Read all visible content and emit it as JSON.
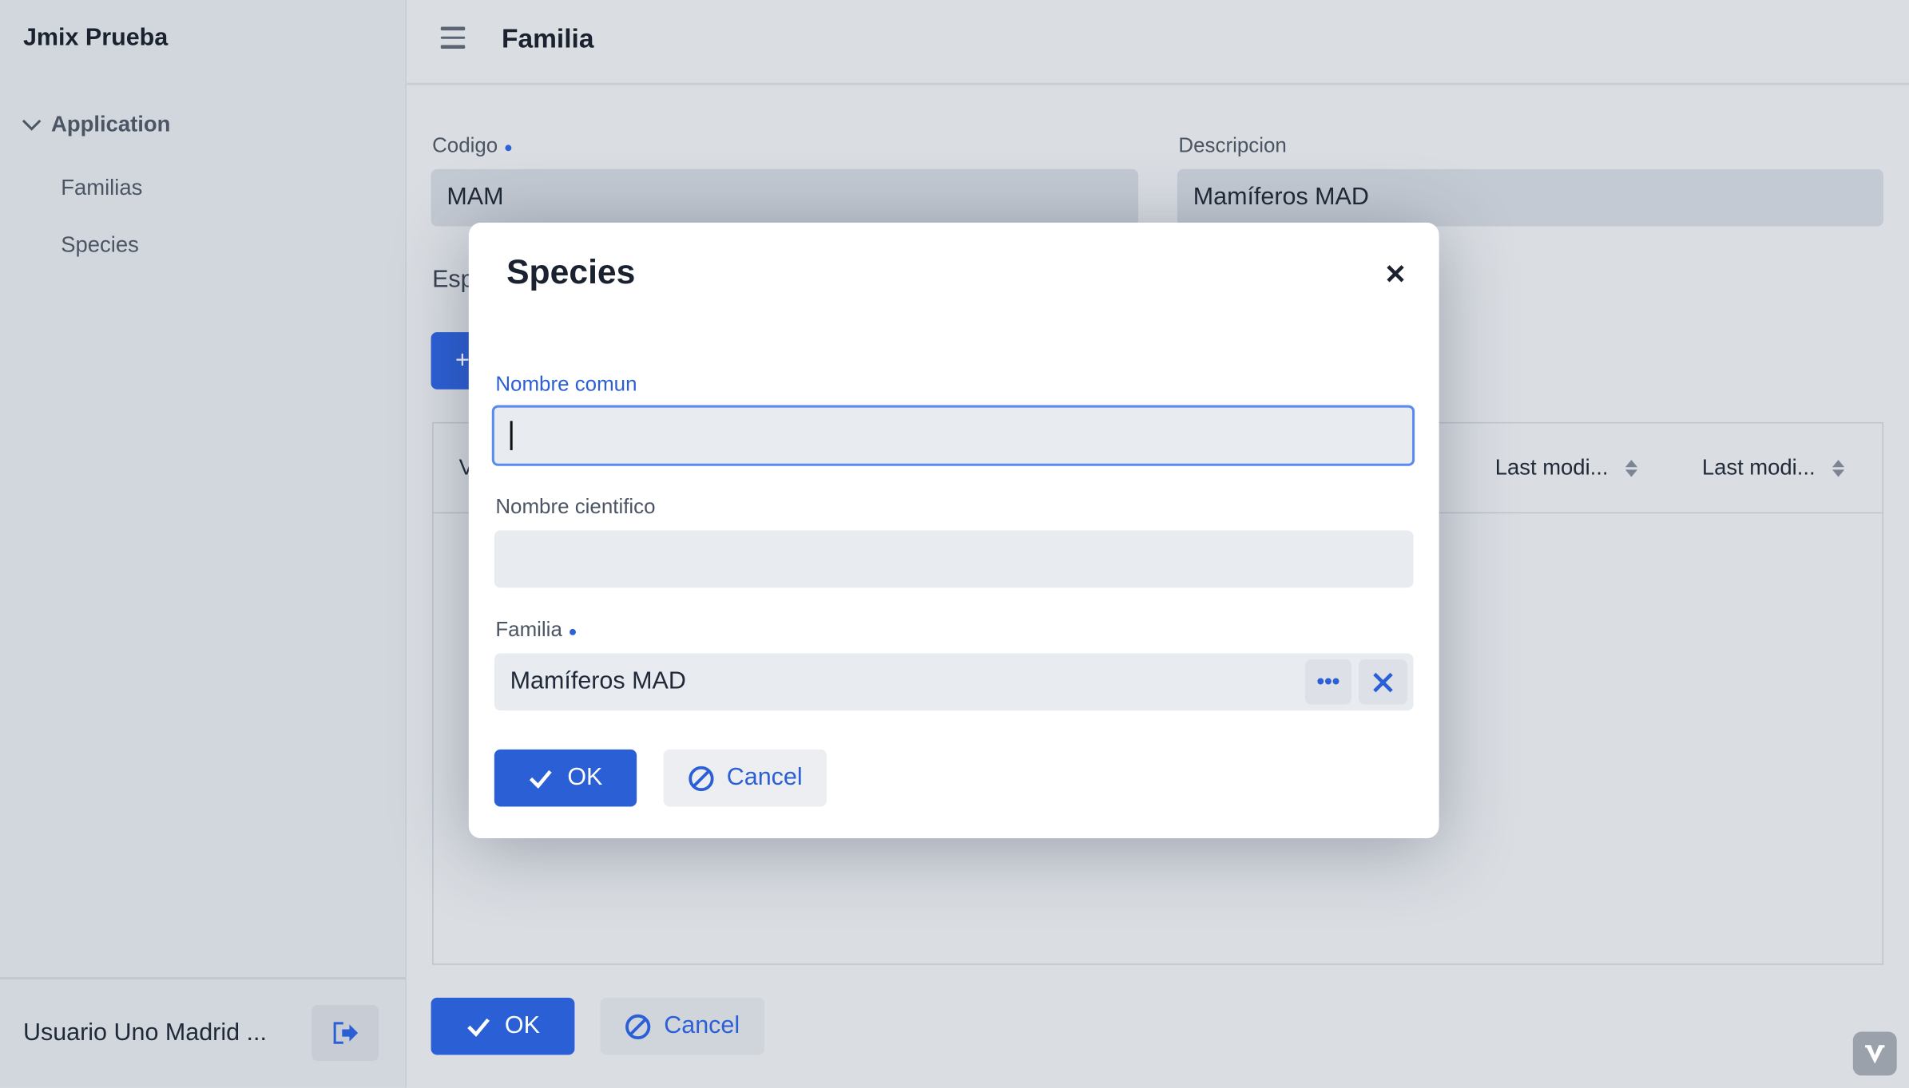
{
  "sidebar": {
    "app_title": "Jmix Prueba",
    "group": "Application",
    "items": [
      {
        "label": "Familias"
      },
      {
        "label": "Species"
      }
    ],
    "user": "Usuario Uno Madrid ..."
  },
  "header": {
    "title": "Familia"
  },
  "form": {
    "codigo_label": "Codigo",
    "codigo_value": "MAM",
    "descripcion_label": "Descripcion",
    "descripcion_value": "Mamíferos MAD",
    "section_label": "Esp",
    "add_label": "+"
  },
  "grid": {
    "columns": [
      "V",
      "Last modi...",
      "Last modi..."
    ]
  },
  "footer": {
    "ok": "OK",
    "cancel": "Cancel"
  },
  "dialog": {
    "title": "Species",
    "nombre_comun_label": "Nombre comun",
    "nombre_comun_value": "",
    "nombre_cientifico_label": "Nombre cientifico",
    "nombre_cientifico_value": "",
    "familia_label": "Familia",
    "familia_value": "Mamíferos MAD",
    "ok": "OK",
    "cancel": "Cancel"
  },
  "colors": {
    "accent": "#2b5fd6",
    "sidebar_bg": "#d2d7de",
    "main_bg": "#dadee3"
  }
}
